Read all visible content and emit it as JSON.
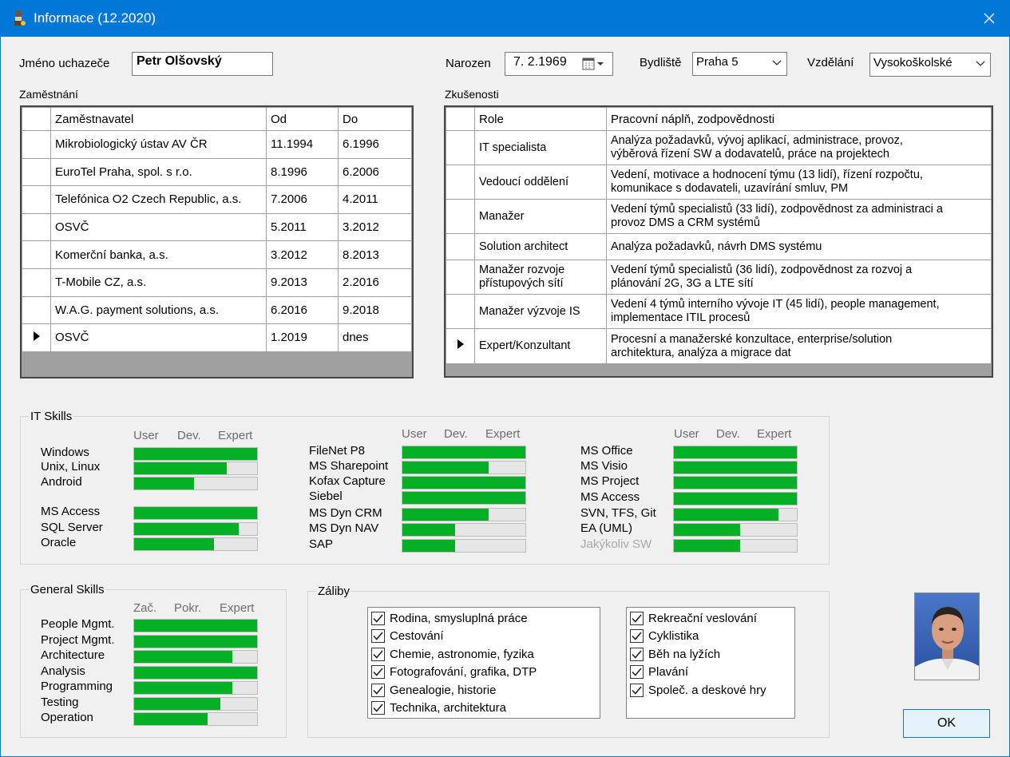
{
  "window": {
    "title": "Informace (12.2020)"
  },
  "form": {
    "name_label": "Jméno uchazeče",
    "name_value": "Petr Olšovský",
    "born_label": "Narozen",
    "born_value": "7.  2.1969",
    "residence_label": "Bydliště",
    "residence_value": "Praha 5",
    "education_label": "Vzdělání",
    "education_value": "Vysokoškolské"
  },
  "employment": {
    "title": "Zaměstnání",
    "columns": [
      "Zaměstnavatel",
      "Od",
      "Do"
    ],
    "rows": [
      {
        "employer": "Mikrobiologický ústav AV ČR",
        "from": "11.1994",
        "to": "6.1996"
      },
      {
        "employer": "EuroTel Praha, spol. s r.o.",
        "from": "8.1996",
        "to": "6.2006"
      },
      {
        "employer": "Telefónica O2 Czech Republic, a.s.",
        "from": "7.2006",
        "to": "4.2011"
      },
      {
        "employer": "OSVČ",
        "from": "5.2011",
        "to": "3.2012"
      },
      {
        "employer": "Komerční banka, a.s.",
        "from": "3.2012",
        "to": "8.2013"
      },
      {
        "employer": "T-Mobile CZ, a.s.",
        "from": "9.2013",
        "to": "2.2016"
      },
      {
        "employer": "W.A.G. payment solutions, a.s.",
        "from": "6.2016",
        "to": "9.2018"
      },
      {
        "employer": "OSVČ",
        "from": "1.2019",
        "to": "dnes"
      }
    ]
  },
  "experience": {
    "title": "Zkušenosti",
    "columns": [
      "Role",
      "Pracovní náplň, zodpovědnosti"
    ],
    "rows": [
      {
        "role": [
          "IT specialista"
        ],
        "duties": [
          "Analýza požadavků, vývoj aplikací, administrace, provoz,",
          "výběrová řízení SW a dodavatelů, práce na projektech"
        ]
      },
      {
        "role": [
          "Vedoucí oddělení"
        ],
        "duties": [
          "Vedení, motivace a hodnocení týmu (13 lidí), řízení rozpočtu,",
          "komunikace s dodavateli, uzavírání smluv, PM"
        ]
      },
      {
        "role": [
          "Manažer"
        ],
        "duties": [
          "Vedení týmů specialistů (33 lidí), zodpovědnost za administraci a",
          "provoz DMS a CRM systémů"
        ]
      },
      {
        "role": [
          "Solution architect"
        ],
        "duties": [
          "Analýza požadavků, návrh DMS systému"
        ]
      },
      {
        "role": [
          "Manažer rozvoje",
          "přístupových sítí"
        ],
        "duties": [
          "Vedení týmů specialistů (36 lidí), zodpovědnost za rozvoj a",
          "plánování 2G, 3G a LTE sítí"
        ]
      },
      {
        "role": [
          "Manažer výzvoje IS"
        ],
        "duties": [
          "Vedení 4 týmů interního vývoje IT (45 lidí), people management,",
          "implementace ITIL procesů"
        ]
      },
      {
        "role": [
          "Expert/Konzultant"
        ],
        "duties": [
          "Procesní a manažerské konzultace, enterprise/solution",
          "architektura, analýza a migrace dat"
        ]
      }
    ]
  },
  "it_skills": {
    "title": "IT Skills",
    "scale": [
      "User",
      "Dev.",
      "Expert"
    ],
    "col1": [
      {
        "name": "Windows",
        "level": 1.0
      },
      {
        "name": "Unix, Linux",
        "level": 0.75
      },
      {
        "name": "Android",
        "level": 0.49
      },
      {
        "name": "MS Access",
        "level": 1.0
      },
      {
        "name": "SQL Server",
        "level": 0.85
      },
      {
        "name": "Oracle",
        "level": 0.65
      }
    ],
    "col2": [
      {
        "name": "FileNet P8",
        "level": 1.0
      },
      {
        "name": "MS Sharepoint",
        "level": 0.7
      },
      {
        "name": "Kofax Capture",
        "level": 1.0
      },
      {
        "name": "Siebel",
        "level": 1.0
      },
      {
        "name": "MS Dyn CRM",
        "level": 0.7
      },
      {
        "name": "MS Dyn NAV",
        "level": 0.43
      },
      {
        "name": "SAP",
        "level": 0.43
      }
    ],
    "col3": [
      {
        "name": "MS Office",
        "level": 1.0
      },
      {
        "name": "MS Visio",
        "level": 1.0
      },
      {
        "name": "MS Project",
        "level": 1.0
      },
      {
        "name": "MS Access",
        "level": 1.0
      },
      {
        "name": "SVN, TFS, Git",
        "level": 0.85
      },
      {
        "name": "EA (UML)",
        "level": 0.54
      },
      {
        "name": "Jakýkoliv SW",
        "level": 0.54
      }
    ]
  },
  "general_skills": {
    "title": "General Skills",
    "scale": [
      "Zač.",
      "Pokr.",
      "Expert"
    ],
    "items": [
      {
        "name": "People Mgmt.",
        "level": 1.0
      },
      {
        "name": "Project Mgmt.",
        "level": 1.0
      },
      {
        "name": "Architecture",
        "level": 0.8
      },
      {
        "name": "Analysis",
        "level": 1.0
      },
      {
        "name": "Programming",
        "level": 0.8
      },
      {
        "name": "Testing",
        "level": 0.7
      },
      {
        "name": "Operation",
        "level": 0.6
      }
    ]
  },
  "hobbies": {
    "title": "Záliby",
    "list1": [
      "Rodina, smysluplná práce",
      "Cestování",
      "Chemie, astronomie, fyzika",
      "Fotografování, grafika, DTP",
      "Genealogie, historie",
      "Technika, architektura"
    ],
    "list2": [
      "Rekreační veslování",
      "Cyklistika",
      "Běh na lyžích",
      "Plavání",
      "Společ. a deskové hry"
    ]
  },
  "buttons": {
    "ok": "OK"
  },
  "colors": {
    "titlebar": "#0078d7",
    "progress": "#06b025",
    "progress_bg": "#e6e6e6"
  }
}
